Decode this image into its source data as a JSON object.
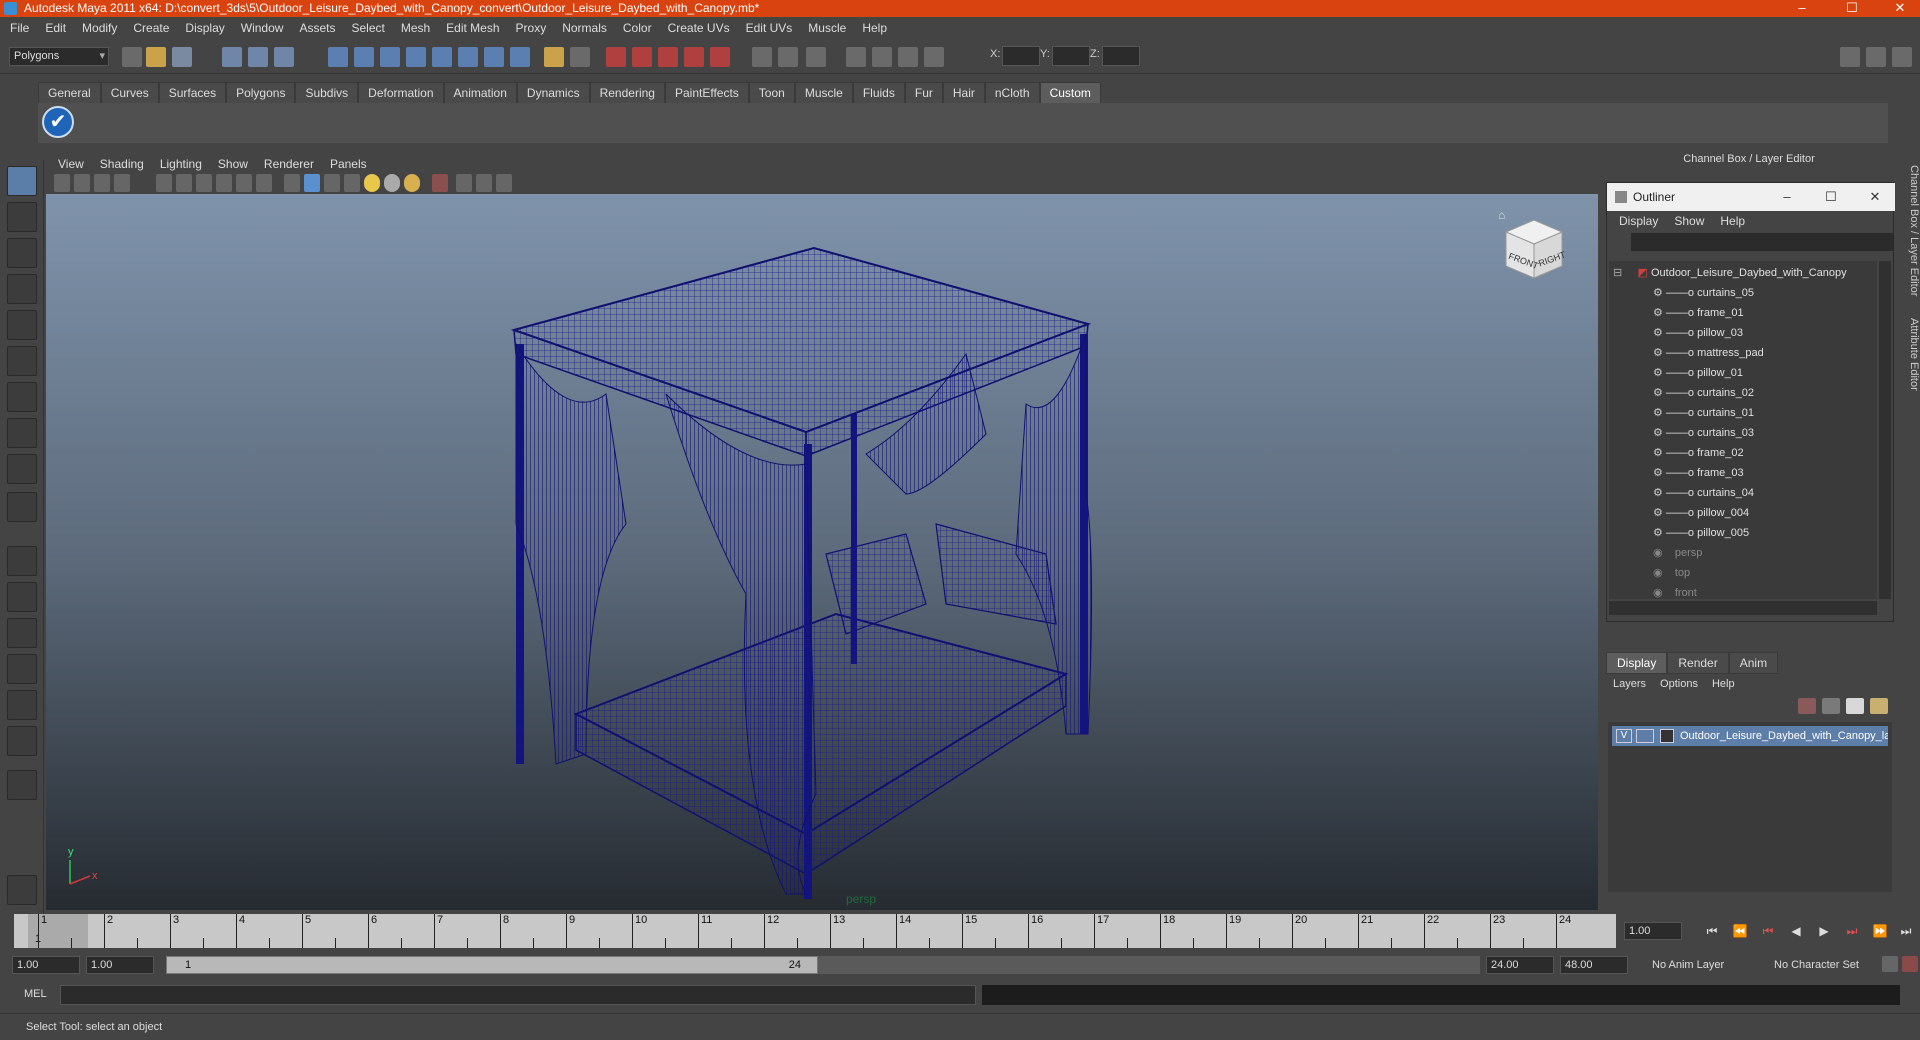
{
  "window": {
    "title": "Autodesk Maya 2011 x64: D:\\convert_3ds\\5\\Outdoor_Leisure_Daybed_with_Canopy_convert\\Outdoor_Leisure_Daybed_with_Canopy.mb*"
  },
  "menubar": [
    "File",
    "Edit",
    "Modify",
    "Create",
    "Display",
    "Window",
    "Assets",
    "Select",
    "Mesh",
    "Edit Mesh",
    "Proxy",
    "Normals",
    "Color",
    "Create UVs",
    "Edit UVs",
    "Muscle",
    "Help"
  ],
  "status": {
    "mode": "Polygons",
    "x_label": "X:",
    "y_label": "Y:",
    "z_label": "Z:"
  },
  "shelf_tabs": [
    "General",
    "Curves",
    "Surfaces",
    "Polygons",
    "Subdivs",
    "Deformation",
    "Animation",
    "Dynamics",
    "Rendering",
    "PaintEffects",
    "Toon",
    "Muscle",
    "Fluids",
    "Fur",
    "Hair",
    "nCloth",
    "Custom"
  ],
  "shelf_active": "Custom",
  "viewport": {
    "menu": [
      "View",
      "Shading",
      "Lighting",
      "Show",
      "Renderer",
      "Panels"
    ],
    "camera": "persp",
    "viewcube_front": "FRONT",
    "viewcube_right": "RIGHT",
    "axis_y": "y",
    "axis_x": "x"
  },
  "channel_box": {
    "title": "Channel Box / Layer Editor"
  },
  "outliner": {
    "title": "Outliner",
    "menu": [
      "Display",
      "Show",
      "Help"
    ],
    "root": "Outdoor_Leisure_Daybed_with_Canopy",
    "children": [
      "curtains_05",
      "frame_01",
      "pillow_03",
      "mattress_pad",
      "pillow_01",
      "curtains_02",
      "curtains_01",
      "curtains_03",
      "frame_02",
      "frame_03",
      "curtains_04",
      "pillow_004",
      "pillow_005"
    ],
    "cameras": [
      "persp",
      "top",
      "front"
    ]
  },
  "layer_editor": {
    "tabs": [
      "Display",
      "Render",
      "Anim"
    ],
    "menu": [
      "Layers",
      "Options",
      "Help"
    ],
    "layer_visible": "V",
    "layer_name": "Outdoor_Leisure_Daybed_with_Canopy_layer"
  },
  "side_tabs": [
    "Channel Box / Layer Editor",
    "Attribute Editor"
  ],
  "timeline": {
    "ticks": [
      "1",
      "2",
      "3",
      "4",
      "5",
      "6",
      "7",
      "8",
      "9",
      "10",
      "11",
      "12",
      "13",
      "14",
      "15",
      "16",
      "17",
      "18",
      "19",
      "20",
      "21",
      "22",
      "23",
      "24"
    ],
    "current": "1"
  },
  "playback": {
    "current_time": "1.00"
  },
  "range": {
    "start_time": "1.00",
    "start_range": "1.00",
    "range_start_label": "1",
    "range_end_label": "24",
    "end_range": "24.00",
    "end_time": "48.00",
    "anim_layer": "No Anim Layer",
    "char_set": "No Character Set"
  },
  "mel": {
    "label": "MEL"
  },
  "help": {
    "text": "Select Tool: select an object"
  }
}
